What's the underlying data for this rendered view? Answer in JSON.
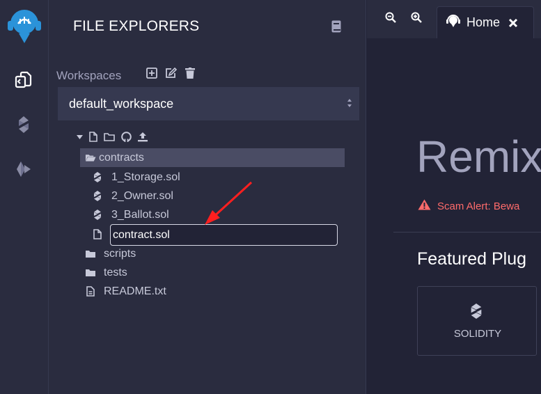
{
  "colors": {
    "background": "#222336",
    "panel": "#2a2c3f",
    "select_bg": "#363950",
    "selected_row": "#4a4c64",
    "text": "#c7c9d9",
    "muted_text": "#a2a3bd",
    "white": "#ffffff",
    "logo_blue": "#2b93d9",
    "scam_red": "#ff6b6b",
    "arrow_red": "#ff1f1f"
  },
  "icon_rail": {
    "logo": "remix-logo-icon",
    "items": [
      {
        "icon": "file-explorer-icon",
        "active": true
      },
      {
        "icon": "solidity-compiler-icon",
        "active": false
      },
      {
        "icon": "deploy-run-icon",
        "active": false
      }
    ]
  },
  "side_panel": {
    "title": "FILE EXPLORERS",
    "title_icon": "book-icon",
    "workspaces_label": "Workspaces",
    "workspace_actions": [
      "create-workspace-icon",
      "rename-workspace-icon",
      "delete-workspace-icon"
    ],
    "selected_workspace": "default_workspace",
    "tree_toolbar": [
      "collapse-caret-icon",
      "new-file-icon",
      "new-folder-icon",
      "github-icon",
      "upload-icon"
    ],
    "tree": {
      "contracts_folder": "contracts",
      "files": [
        "1_Storage.sol",
        "2_Owner.sol",
        "3_Ballot.sol"
      ],
      "new_file_input": "contract.sol",
      "folders": [
        "scripts",
        "tests"
      ],
      "readme": "README.txt"
    }
  },
  "main": {
    "tabs": {
      "zoom_out": "zoom-out-icon",
      "zoom_in": "zoom-in-icon",
      "home_label": "Home"
    },
    "hero_title": "Remix",
    "scam_alert": "Scam Alert: Bewa",
    "featured_title": "Featured Plug",
    "plugin_name": "SOLIDITY"
  }
}
